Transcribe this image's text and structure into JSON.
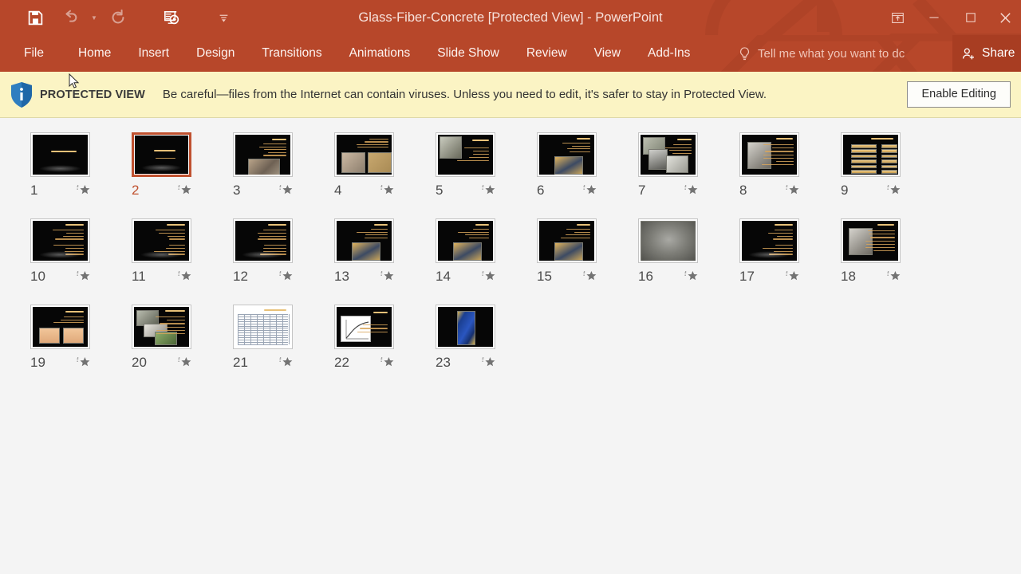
{
  "window": {
    "title": "Glass-Fiber-Concrete [Protected View] - PowerPoint",
    "quick_access": [
      {
        "name": "save",
        "icon": "save-icon",
        "label": "Save",
        "enabled": true
      },
      {
        "name": "undo",
        "icon": "undo-icon",
        "label": "Undo",
        "enabled": false
      },
      {
        "name": "redo",
        "icon": "redo-icon",
        "label": "Repeat",
        "enabled": false
      },
      {
        "name": "start-presentation",
        "icon": "slideshow-icon",
        "label": "Start From Beginning",
        "enabled": true
      },
      {
        "name": "customize-qat",
        "icon": "chevron-down-icon",
        "label": "Customize Quick Access Toolbar",
        "enabled": true
      }
    ],
    "controls": [
      {
        "name": "ribbon-display-options",
        "icon": "ribbon-options-icon",
        "label": "Ribbon Display Options"
      },
      {
        "name": "minimize",
        "icon": "minimize-icon",
        "label": "Minimize"
      },
      {
        "name": "restore",
        "icon": "restore-icon",
        "label": "Restore Down"
      },
      {
        "name": "close",
        "icon": "close-icon",
        "label": "Close"
      }
    ]
  },
  "ribbon": {
    "tabs": [
      {
        "label": "File"
      },
      {
        "label": "Home"
      },
      {
        "label": "Insert"
      },
      {
        "label": "Design"
      },
      {
        "label": "Transitions"
      },
      {
        "label": "Animations"
      },
      {
        "label": "Slide Show"
      },
      {
        "label": "Review"
      },
      {
        "label": "View"
      },
      {
        "label": "Add-Ins"
      }
    ],
    "tell_me": "Tell me what you want to dc",
    "tell_me_icon": "lightbulb-icon",
    "share_label": "Share",
    "share_icon": "person-add-icon"
  },
  "protected_view": {
    "icon": "info-shield-icon",
    "label": "PROTECTED VIEW",
    "message": "Be careful—files from the Internet can contain viruses. Unless you need to edit, it's safer to stay in Protected View.",
    "enable_button": "Enable Editing"
  },
  "slide_sorter": {
    "selected_slide": 2,
    "star_icon": "animation-star-icon",
    "slides": [
      {
        "number": "1",
        "kind": "title-center",
        "selected": false
      },
      {
        "number": "2",
        "kind": "title-sub",
        "selected": true
      },
      {
        "number": "3",
        "kind": "text-image-bottom",
        "selected": false
      },
      {
        "number": "4",
        "kind": "two-images",
        "selected": false
      },
      {
        "number": "5",
        "kind": "image-left-text",
        "selected": false
      },
      {
        "number": "6",
        "kind": "text-image-center",
        "selected": false
      },
      {
        "number": "7",
        "kind": "collage",
        "selected": false
      },
      {
        "number": "8",
        "kind": "image-left-list",
        "selected": false
      },
      {
        "number": "9",
        "kind": "table-bars",
        "selected": false
      },
      {
        "number": "10",
        "kind": "text-only",
        "selected": false
      },
      {
        "number": "11",
        "kind": "text-only",
        "selected": false
      },
      {
        "number": "12",
        "kind": "text-only",
        "selected": false
      },
      {
        "number": "13",
        "kind": "text-image-center",
        "selected": false
      },
      {
        "number": "14",
        "kind": "text-image-center",
        "selected": false
      },
      {
        "number": "15",
        "kind": "text-image-center",
        "selected": false
      },
      {
        "number": "16",
        "kind": "full-photo",
        "selected": false
      },
      {
        "number": "17",
        "kind": "text-only",
        "selected": false
      },
      {
        "number": "18",
        "kind": "image-left-list",
        "selected": false
      },
      {
        "number": "19",
        "kind": "two-boxes",
        "selected": false
      },
      {
        "number": "20",
        "kind": "collage-right-text",
        "selected": false
      },
      {
        "number": "21",
        "kind": "spreadsheet",
        "selected": false
      },
      {
        "number": "22",
        "kind": "chart-text",
        "selected": false
      },
      {
        "number": "23",
        "kind": "product-photo",
        "selected": false
      }
    ]
  },
  "colors": {
    "brand": "#b7472a",
    "share_bg": "#a83d22",
    "protected_bar": "#fbf4c4",
    "selection": "#c0512f",
    "page_bg": "#f4f4f4"
  }
}
